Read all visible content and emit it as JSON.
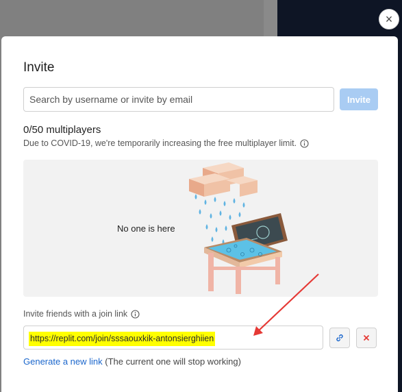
{
  "background": {
    "left_color": "#808080",
    "right_color": "#0e1525"
  },
  "close": {
    "icon": "close-icon",
    "glyph": "×"
  },
  "modal": {
    "title": "Invite",
    "search": {
      "placeholder": "Search by username or invite by email",
      "value": ""
    },
    "invite_button": "Invite",
    "multiplayer_count": "0/50 multiplayers",
    "notice": "Due to COVID-19, we're temporarily increasing the free multiplayer limit.",
    "empty_state": "No one is here",
    "join_link_label": "Invite friends with a join link",
    "join_link": "https://replit.com/join/sssaouxkik-antonsierghiien",
    "generate_link": "Generate a new link",
    "generate_note": " (The current one will stop working)"
  },
  "colors": {
    "accent": "#1a66cc",
    "invite_button": "#a9ccf3",
    "highlight": "#ffff00",
    "annotation_arrow": "#e53935",
    "delete_icon": "#e53935"
  }
}
